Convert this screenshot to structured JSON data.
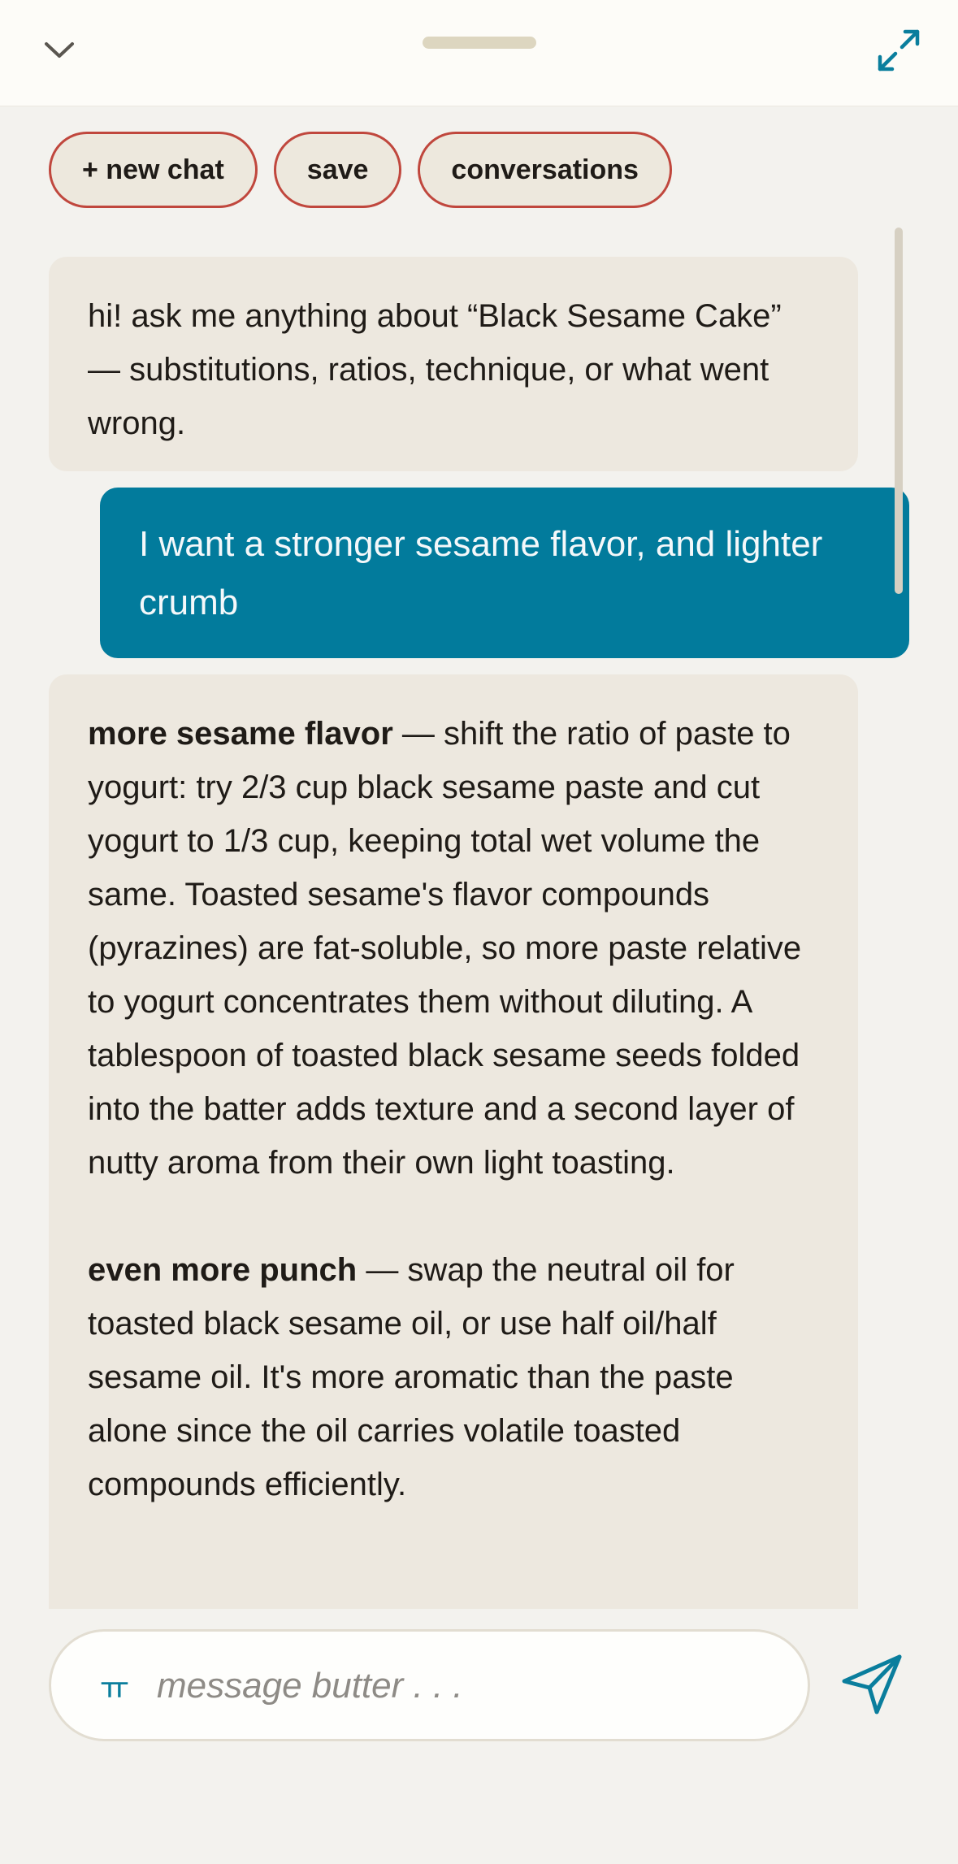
{
  "header": {
    "collapse_icon": "chevron-down-icon",
    "expand_icon": "expand-arrows-icon"
  },
  "actions": {
    "new_chat_label": "+ new chat",
    "save_label": "save",
    "conversations_label": "conversations"
  },
  "messages": [
    {
      "role": "assistant",
      "text": "hi! ask me anything about “Black Sesame Cake” — substitutions, ratios, technique, or what went wrong."
    },
    {
      "role": "user",
      "text": "I want a stronger  sesame flavor,  and lighter crumb"
    },
    {
      "role": "assistant",
      "paragraphs": [
        {
          "heading": "more sesame flavor",
          "body": " — shift the ratio of paste to yogurt: try 2/3 cup black sesame paste and cut yogurt to 1/3 cup, keeping total wet volume the same. Toasted sesame's flavor compounds (pyrazines) are fat-soluble, so more paste relative to yogurt concentrates them without diluting. A tablespoon of toasted black sesame seeds folded into the batter adds texture and a second layer of nutty aroma from their own light toasting."
        },
        {
          "heading": "even more punch",
          "body": " — swap the neutral oil for toasted black sesame oil, or use half oil/half sesame oil. It's more aromatic than the paste alone since the oil carries volatile toasted compounds efficiently."
        }
      ]
    }
  ],
  "composer": {
    "format_icon": "text-format-icon",
    "format_glyph": "ㅠ",
    "placeholder": "message butter . . .",
    "send_icon": "send-icon"
  },
  "colors": {
    "accent": "#027b9c",
    "pill_border": "#c0473d",
    "bot_bubble": "#ede8df",
    "background": "#f3f2ee"
  }
}
